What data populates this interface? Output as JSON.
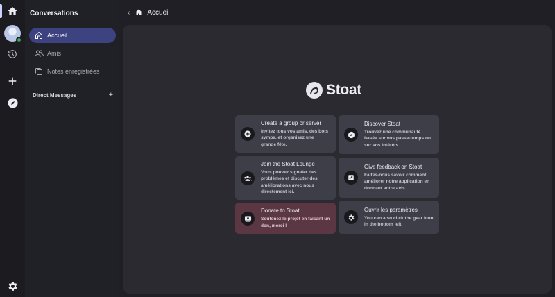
{
  "sidebar": {
    "title": "Conversations",
    "items": [
      {
        "label": "Accueil",
        "icon": "home-icon",
        "active": true
      },
      {
        "label": "Amis",
        "icon": "friends-icon",
        "active": false
      },
      {
        "label": "Notes enregistrées",
        "icon": "notes-icon",
        "active": false
      }
    ],
    "dm_header": "Direct Messages",
    "dm_add": "+"
  },
  "header": {
    "back": "‹",
    "title": "Accueil"
  },
  "main": {
    "logo_text": "Stoat",
    "cards": [
      {
        "title": "Create a group or server",
        "desc": "Invitez tous vos amis, des bots sympa, et organisez une grande fête.",
        "icon": "plus-circle-icon"
      },
      {
        "title": "Discover Stoat",
        "desc": "Trouvez une communauté basée sur vos passe-temps ou sur vos intérêts.",
        "icon": "compass-icon"
      },
      {
        "title": "Join the Stoat Lounge",
        "desc": "Vous pouvez signaler des problèmes et discuter des améliorations avec nous directement ici.",
        "icon": "group-icon"
      },
      {
        "title": "Give feedback on Stoat",
        "desc": "Faites-nous savoir comment améliorer notre application en donnant votre avis.",
        "icon": "feedback-icon"
      },
      {
        "title": "Donate to Stoat",
        "desc": "Soutenez le projet en faisant un don, merci !",
        "icon": "donate-icon"
      },
      {
        "title": "Ouvrir les paramètres",
        "desc": "You can also click the gear icon in the bottom left.",
        "icon": "gear-icon"
      }
    ]
  },
  "colors": {
    "accent": "#3d4280",
    "donate": "#5b3743",
    "card": "#3e3e49",
    "online": "#3ba55c"
  }
}
